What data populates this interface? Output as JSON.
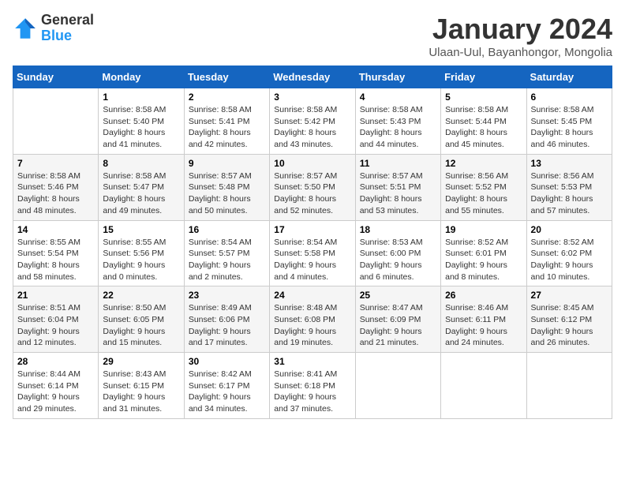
{
  "logo": {
    "general": "General",
    "blue": "Blue"
  },
  "header": {
    "title": "January 2024",
    "subtitle": "Ulaan-Uul, Bayanhongor, Mongolia"
  },
  "weekdays": [
    "Sunday",
    "Monday",
    "Tuesday",
    "Wednesday",
    "Thursday",
    "Friday",
    "Saturday"
  ],
  "weeks": [
    [
      {
        "day": "",
        "info": ""
      },
      {
        "day": "1",
        "info": "Sunrise: 8:58 AM\nSunset: 5:40 PM\nDaylight: 8 hours\nand 41 minutes."
      },
      {
        "day": "2",
        "info": "Sunrise: 8:58 AM\nSunset: 5:41 PM\nDaylight: 8 hours\nand 42 minutes."
      },
      {
        "day": "3",
        "info": "Sunrise: 8:58 AM\nSunset: 5:42 PM\nDaylight: 8 hours\nand 43 minutes."
      },
      {
        "day": "4",
        "info": "Sunrise: 8:58 AM\nSunset: 5:43 PM\nDaylight: 8 hours\nand 44 minutes."
      },
      {
        "day": "5",
        "info": "Sunrise: 8:58 AM\nSunset: 5:44 PM\nDaylight: 8 hours\nand 45 minutes."
      },
      {
        "day": "6",
        "info": "Sunrise: 8:58 AM\nSunset: 5:45 PM\nDaylight: 8 hours\nand 46 minutes."
      }
    ],
    [
      {
        "day": "7",
        "info": "Sunrise: 8:58 AM\nSunset: 5:46 PM\nDaylight: 8 hours\nand 48 minutes."
      },
      {
        "day": "8",
        "info": "Sunrise: 8:58 AM\nSunset: 5:47 PM\nDaylight: 8 hours\nand 49 minutes."
      },
      {
        "day": "9",
        "info": "Sunrise: 8:57 AM\nSunset: 5:48 PM\nDaylight: 8 hours\nand 50 minutes."
      },
      {
        "day": "10",
        "info": "Sunrise: 8:57 AM\nSunset: 5:50 PM\nDaylight: 8 hours\nand 52 minutes."
      },
      {
        "day": "11",
        "info": "Sunrise: 8:57 AM\nSunset: 5:51 PM\nDaylight: 8 hours\nand 53 minutes."
      },
      {
        "day": "12",
        "info": "Sunrise: 8:56 AM\nSunset: 5:52 PM\nDaylight: 8 hours\nand 55 minutes."
      },
      {
        "day": "13",
        "info": "Sunrise: 8:56 AM\nSunset: 5:53 PM\nDaylight: 8 hours\nand 57 minutes."
      }
    ],
    [
      {
        "day": "14",
        "info": "Sunrise: 8:55 AM\nSunset: 5:54 PM\nDaylight: 8 hours\nand 58 minutes."
      },
      {
        "day": "15",
        "info": "Sunrise: 8:55 AM\nSunset: 5:56 PM\nDaylight: 9 hours\nand 0 minutes."
      },
      {
        "day": "16",
        "info": "Sunrise: 8:54 AM\nSunset: 5:57 PM\nDaylight: 9 hours\nand 2 minutes."
      },
      {
        "day": "17",
        "info": "Sunrise: 8:54 AM\nSunset: 5:58 PM\nDaylight: 9 hours\nand 4 minutes."
      },
      {
        "day": "18",
        "info": "Sunrise: 8:53 AM\nSunset: 6:00 PM\nDaylight: 9 hours\nand 6 minutes."
      },
      {
        "day": "19",
        "info": "Sunrise: 8:52 AM\nSunset: 6:01 PM\nDaylight: 9 hours\nand 8 minutes."
      },
      {
        "day": "20",
        "info": "Sunrise: 8:52 AM\nSunset: 6:02 PM\nDaylight: 9 hours\nand 10 minutes."
      }
    ],
    [
      {
        "day": "21",
        "info": "Sunrise: 8:51 AM\nSunset: 6:04 PM\nDaylight: 9 hours\nand 12 minutes."
      },
      {
        "day": "22",
        "info": "Sunrise: 8:50 AM\nSunset: 6:05 PM\nDaylight: 9 hours\nand 15 minutes."
      },
      {
        "day": "23",
        "info": "Sunrise: 8:49 AM\nSunset: 6:06 PM\nDaylight: 9 hours\nand 17 minutes."
      },
      {
        "day": "24",
        "info": "Sunrise: 8:48 AM\nSunset: 6:08 PM\nDaylight: 9 hours\nand 19 minutes."
      },
      {
        "day": "25",
        "info": "Sunrise: 8:47 AM\nSunset: 6:09 PM\nDaylight: 9 hours\nand 21 minutes."
      },
      {
        "day": "26",
        "info": "Sunrise: 8:46 AM\nSunset: 6:11 PM\nDaylight: 9 hours\nand 24 minutes."
      },
      {
        "day": "27",
        "info": "Sunrise: 8:45 AM\nSunset: 6:12 PM\nDaylight: 9 hours\nand 26 minutes."
      }
    ],
    [
      {
        "day": "28",
        "info": "Sunrise: 8:44 AM\nSunset: 6:14 PM\nDaylight: 9 hours\nand 29 minutes."
      },
      {
        "day": "29",
        "info": "Sunrise: 8:43 AM\nSunset: 6:15 PM\nDaylight: 9 hours\nand 31 minutes."
      },
      {
        "day": "30",
        "info": "Sunrise: 8:42 AM\nSunset: 6:17 PM\nDaylight: 9 hours\nand 34 minutes."
      },
      {
        "day": "31",
        "info": "Sunrise: 8:41 AM\nSunset: 6:18 PM\nDaylight: 9 hours\nand 37 minutes."
      },
      {
        "day": "",
        "info": ""
      },
      {
        "day": "",
        "info": ""
      },
      {
        "day": "",
        "info": ""
      }
    ]
  ]
}
